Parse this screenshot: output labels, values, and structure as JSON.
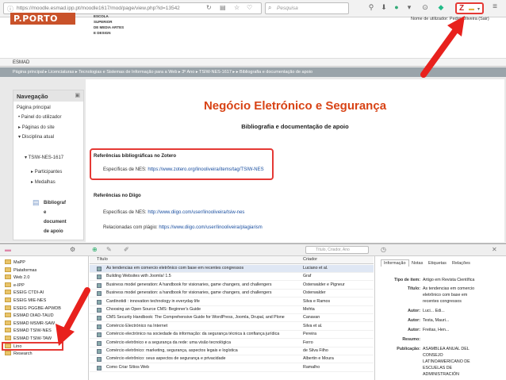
{
  "browser": {
    "url": "https://moodle.esmad.ipp.pt/moodle1617/mod/page/view.php?id=13542",
    "search_placeholder": "Pesquisa"
  },
  "moodle": {
    "logo": "P.PORTO",
    "school_lines": "ESCOLA\nSUPERIOR\nDE MEDIA ARTES\nE DESIGN",
    "user": "Nome de utilizador: Pedro Oliveira (Sair)",
    "context": "ESMAD",
    "breadcrumb": "Página principal ▸ Licenciaturas ▸ Tecnologias e Sistemas de Informação para a Web ▸ 3º Ano ▸ TSIW-NES-1617 ▸ ▸ Bibliografia e documentação de apoio",
    "nav": {
      "title": "Navegação",
      "items": [
        "Página principal",
        "Painel do utilizador",
        "Páginas do site",
        "Disciplina atual",
        "TSIW-NES-1617",
        "Participantes",
        "Medalhas",
        "Bibliograf",
        "e",
        "document",
        "de apoio"
      ]
    },
    "page_title": "Negócio Eletrónico e Segurança",
    "page_subtitle": "Bibliografia e documentação de apoio",
    "zotero_heading": "Referências bibliográficas no Zotero",
    "zotero_label": "Específicas de NES:",
    "zotero_link": "https://www.zotero.org/linooliveira/items/tag/TSIW-NES",
    "diigo_heading": "Referências no Diigo",
    "diigo_label": "Específicas de NES:",
    "diigo_link": "http://www.diigo.com/user/linooliveira/tsiw-nes",
    "plagio_label": "Relacionadas com plágio:",
    "plagio_link": "https://www.diigo.com/user/linooliveira/plagiarism"
  },
  "zotero": {
    "search_placeholder": "Título, Criador, Ano",
    "collections": [
      "MaPP",
      "Plataformas",
      "Web 2.0",
      "e-IPP",
      "ESEIG CTDI-AI",
      "ESEIG MIE-NES",
      "ESEIG PGGBE-APWDB",
      "ESMAD DIAD-TAUD",
      "ESMAD MSMR-SAW",
      "ESMAD TSIW-NES",
      "ESMAD TSIW-TAW",
      "Lino",
      "Research"
    ],
    "columns": {
      "title": "Título",
      "creator": "Criador"
    },
    "items": [
      {
        "title": "As tendencias em comercio eletrônico com base em recentes congressos",
        "creator": "Luciano et al."
      },
      {
        "title": "Building Websites with Joomla! 1.5",
        "creator": "Graf"
      },
      {
        "title": "Business model generation: A handbook for visionaries, game changers, and challengers",
        "creator": "Osterwalder e Pigneur"
      },
      {
        "title": "Business model generation: a handbook for visionaries, game changers, and challengers",
        "creator": "Osterwalder"
      },
      {
        "title": "Cardinotidi : innovation technology in everyday life",
        "creator": "Silva e Ramos"
      },
      {
        "title": "Choosing an Open Source CMS: Beginner's Guide",
        "creator": "Mehta"
      },
      {
        "title": "CMS Security Handbook: The Comprehensive Guide for WordPress, Joomla, Drupal, and Plone",
        "creator": "Canavan"
      },
      {
        "title": "Comércio Electrónico na Internet",
        "creator": "Silva et al."
      },
      {
        "title": "Comércio electrónico na sociedade da informação: da segurança técnica à confiança jurídica",
        "creator": "Pereira"
      },
      {
        "title": "Comércio eletrônico e a segurança da rede: uma visão tecnológica",
        "creator": "Ferro"
      },
      {
        "title": "Comércio eletrônico: marketing, segurança, aspectos legais e logística",
        "creator": "de Silva Filho"
      },
      {
        "title": "Comércio eletrônico: seus aspectos de segurança e privacidade",
        "creator": "Albertin e Moura"
      },
      {
        "title": "Como Criar Sítios Web",
        "creator": "Ramalho"
      }
    ],
    "tabs": [
      "Informação",
      "Notas",
      "Etiquetas",
      "Relações"
    ],
    "info": {
      "type_label": "Tipo de item:",
      "type_value": "Artigo em Revista Científica",
      "title_label": "Título:",
      "title_lines": [
        "As tendencias em comercio",
        "eletrônico com base em",
        "recentes congressos"
      ],
      "author_label": "Autor:",
      "authors": [
        "Luci... Edi...",
        "Testa, Mauri...",
        "Freitas, Hen..."
      ],
      "abstract_label": "Resumo:",
      "pub_label": "Publicação:",
      "pub_lines": [
        "ASAMBLEA ANUAL DEL",
        "CONSEJO",
        "LATINOAMERICANO DE",
        "ESCUELAS DE",
        "ADMINISTRACIÓN"
      ]
    }
  },
  "colors": {
    "accent": "#d84315",
    "highlight": "#e53935",
    "arrow": "#e8211d"
  }
}
